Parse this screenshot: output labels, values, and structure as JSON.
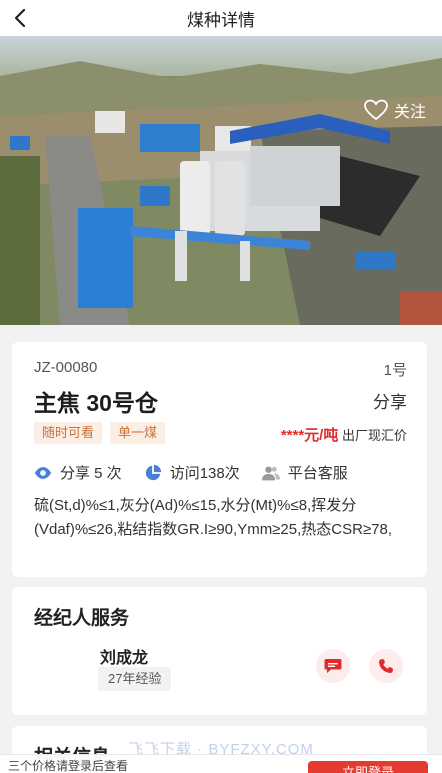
{
  "header": {
    "title": "煤种详情",
    "back_icon": "chevron-left-icon"
  },
  "hero": {
    "follow_label": "关注",
    "follow_icon": "heart-outline-icon"
  },
  "product": {
    "code": "JZ-00080",
    "index": "1号",
    "name": "主焦 30号仓",
    "share_label": "分享",
    "tags": [
      "随时可看",
      "单一煤"
    ],
    "price_masked": "****元/吨",
    "price_note": "出厂现汇价",
    "stats": {
      "share": "分享 5 次",
      "visits": "访问138次",
      "service": "平台客服"
    },
    "spec": "硫(St,d)%≤1,灰分(Ad)%≤15,水分(Mt)%≤8,挥发分(Vdaf)%≤26,粘结指数GR.I≥90,Ymm≥25,热态CSR≥78,"
  },
  "broker": {
    "title": "经纪人服务",
    "name": "刘成龙",
    "experience": "27年经验"
  },
  "related": {
    "title": "相关信息"
  },
  "footer": {
    "notice": "三个价格请登录后查看",
    "login_label": "立即登录"
  },
  "watermark": "飞飞下载 · BYFZXY.COM",
  "colors": {
    "accent": "#e12b2b",
    "tag_text": "#c9733a",
    "tag_bg": "#fbeee4",
    "icon_blue": "#4a7fd6"
  }
}
